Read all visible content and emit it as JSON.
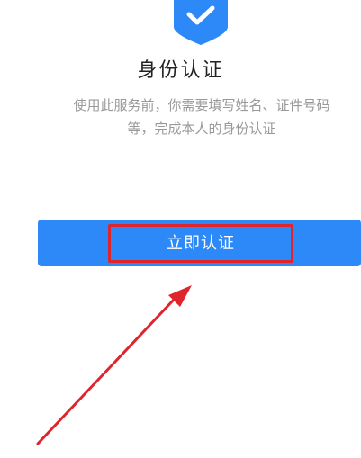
{
  "header": {
    "title": "身份认证"
  },
  "description": {
    "line1": "使用此服务前，你需要填写姓名、证件号码",
    "line2": "等，完成本人的身份认证"
  },
  "actions": {
    "verify_now": "立即认证"
  },
  "colors": {
    "accent": "#2d88f8",
    "annotation_red": "#e0242c",
    "muted_text": "#999999"
  },
  "icons": {
    "badge": "shield-check-icon",
    "annotation": "red-arrow-annotation"
  }
}
